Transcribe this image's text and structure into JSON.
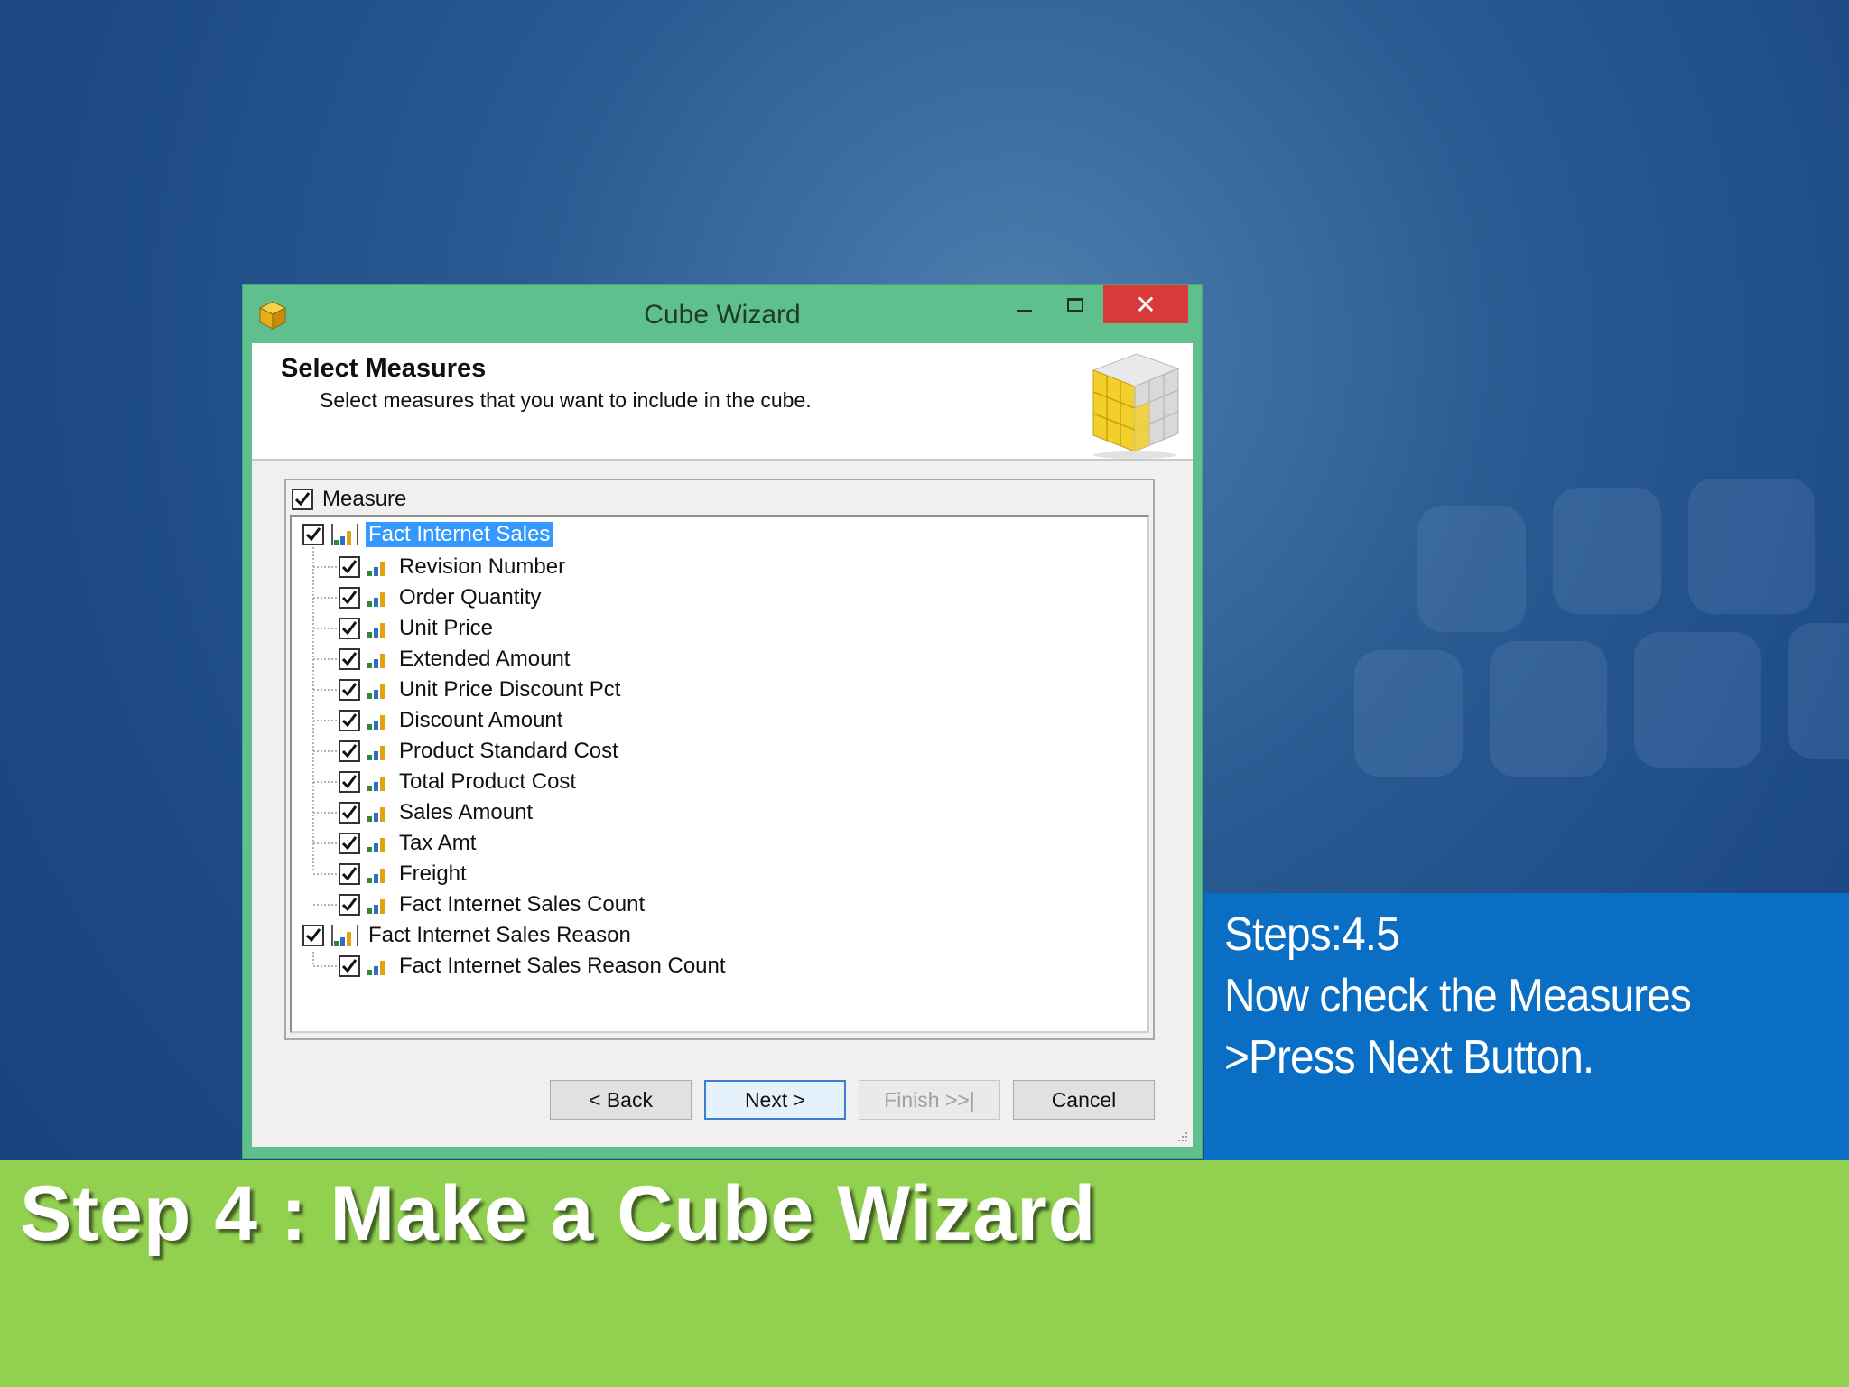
{
  "window": {
    "title": "Cube Wizard",
    "close_glyph": "✕"
  },
  "header": {
    "title": "Select Measures",
    "subtitle": "Select measures that you want to include in the cube."
  },
  "tree": {
    "column_header": "Measure",
    "groups": [
      {
        "label": "Fact Internet Sales",
        "checked": true,
        "selected": true,
        "items": [
          "Revision Number",
          "Order Quantity",
          "Unit Price",
          "Extended Amount",
          "Unit Price Discount Pct",
          "Discount Amount",
          "Product Standard Cost",
          "Total Product Cost",
          "Sales Amount",
          "Tax Amt",
          "Freight",
          "Fact Internet Sales Count"
        ]
      },
      {
        "label": "Fact Internet Sales Reason",
        "checked": true,
        "selected": false,
        "items": [
          "Fact Internet Sales Reason Count"
        ]
      }
    ]
  },
  "buttons": {
    "back": "< Back",
    "next": "Next >",
    "finish": "Finish >>|",
    "cancel": "Cancel"
  },
  "instructions": {
    "line1": "Steps:4.5",
    "line2": "Now check the Measures",
    "line3": ">Press Next Button."
  },
  "slide": {
    "title": "Step 4 : Make a Cube Wizard"
  },
  "colors": {
    "titlebar": "#5fbf8d",
    "close": "#d83a3a",
    "selection": "#3399ff",
    "step_box": "#0a6fc4",
    "bottom_bar": "#92d050"
  }
}
